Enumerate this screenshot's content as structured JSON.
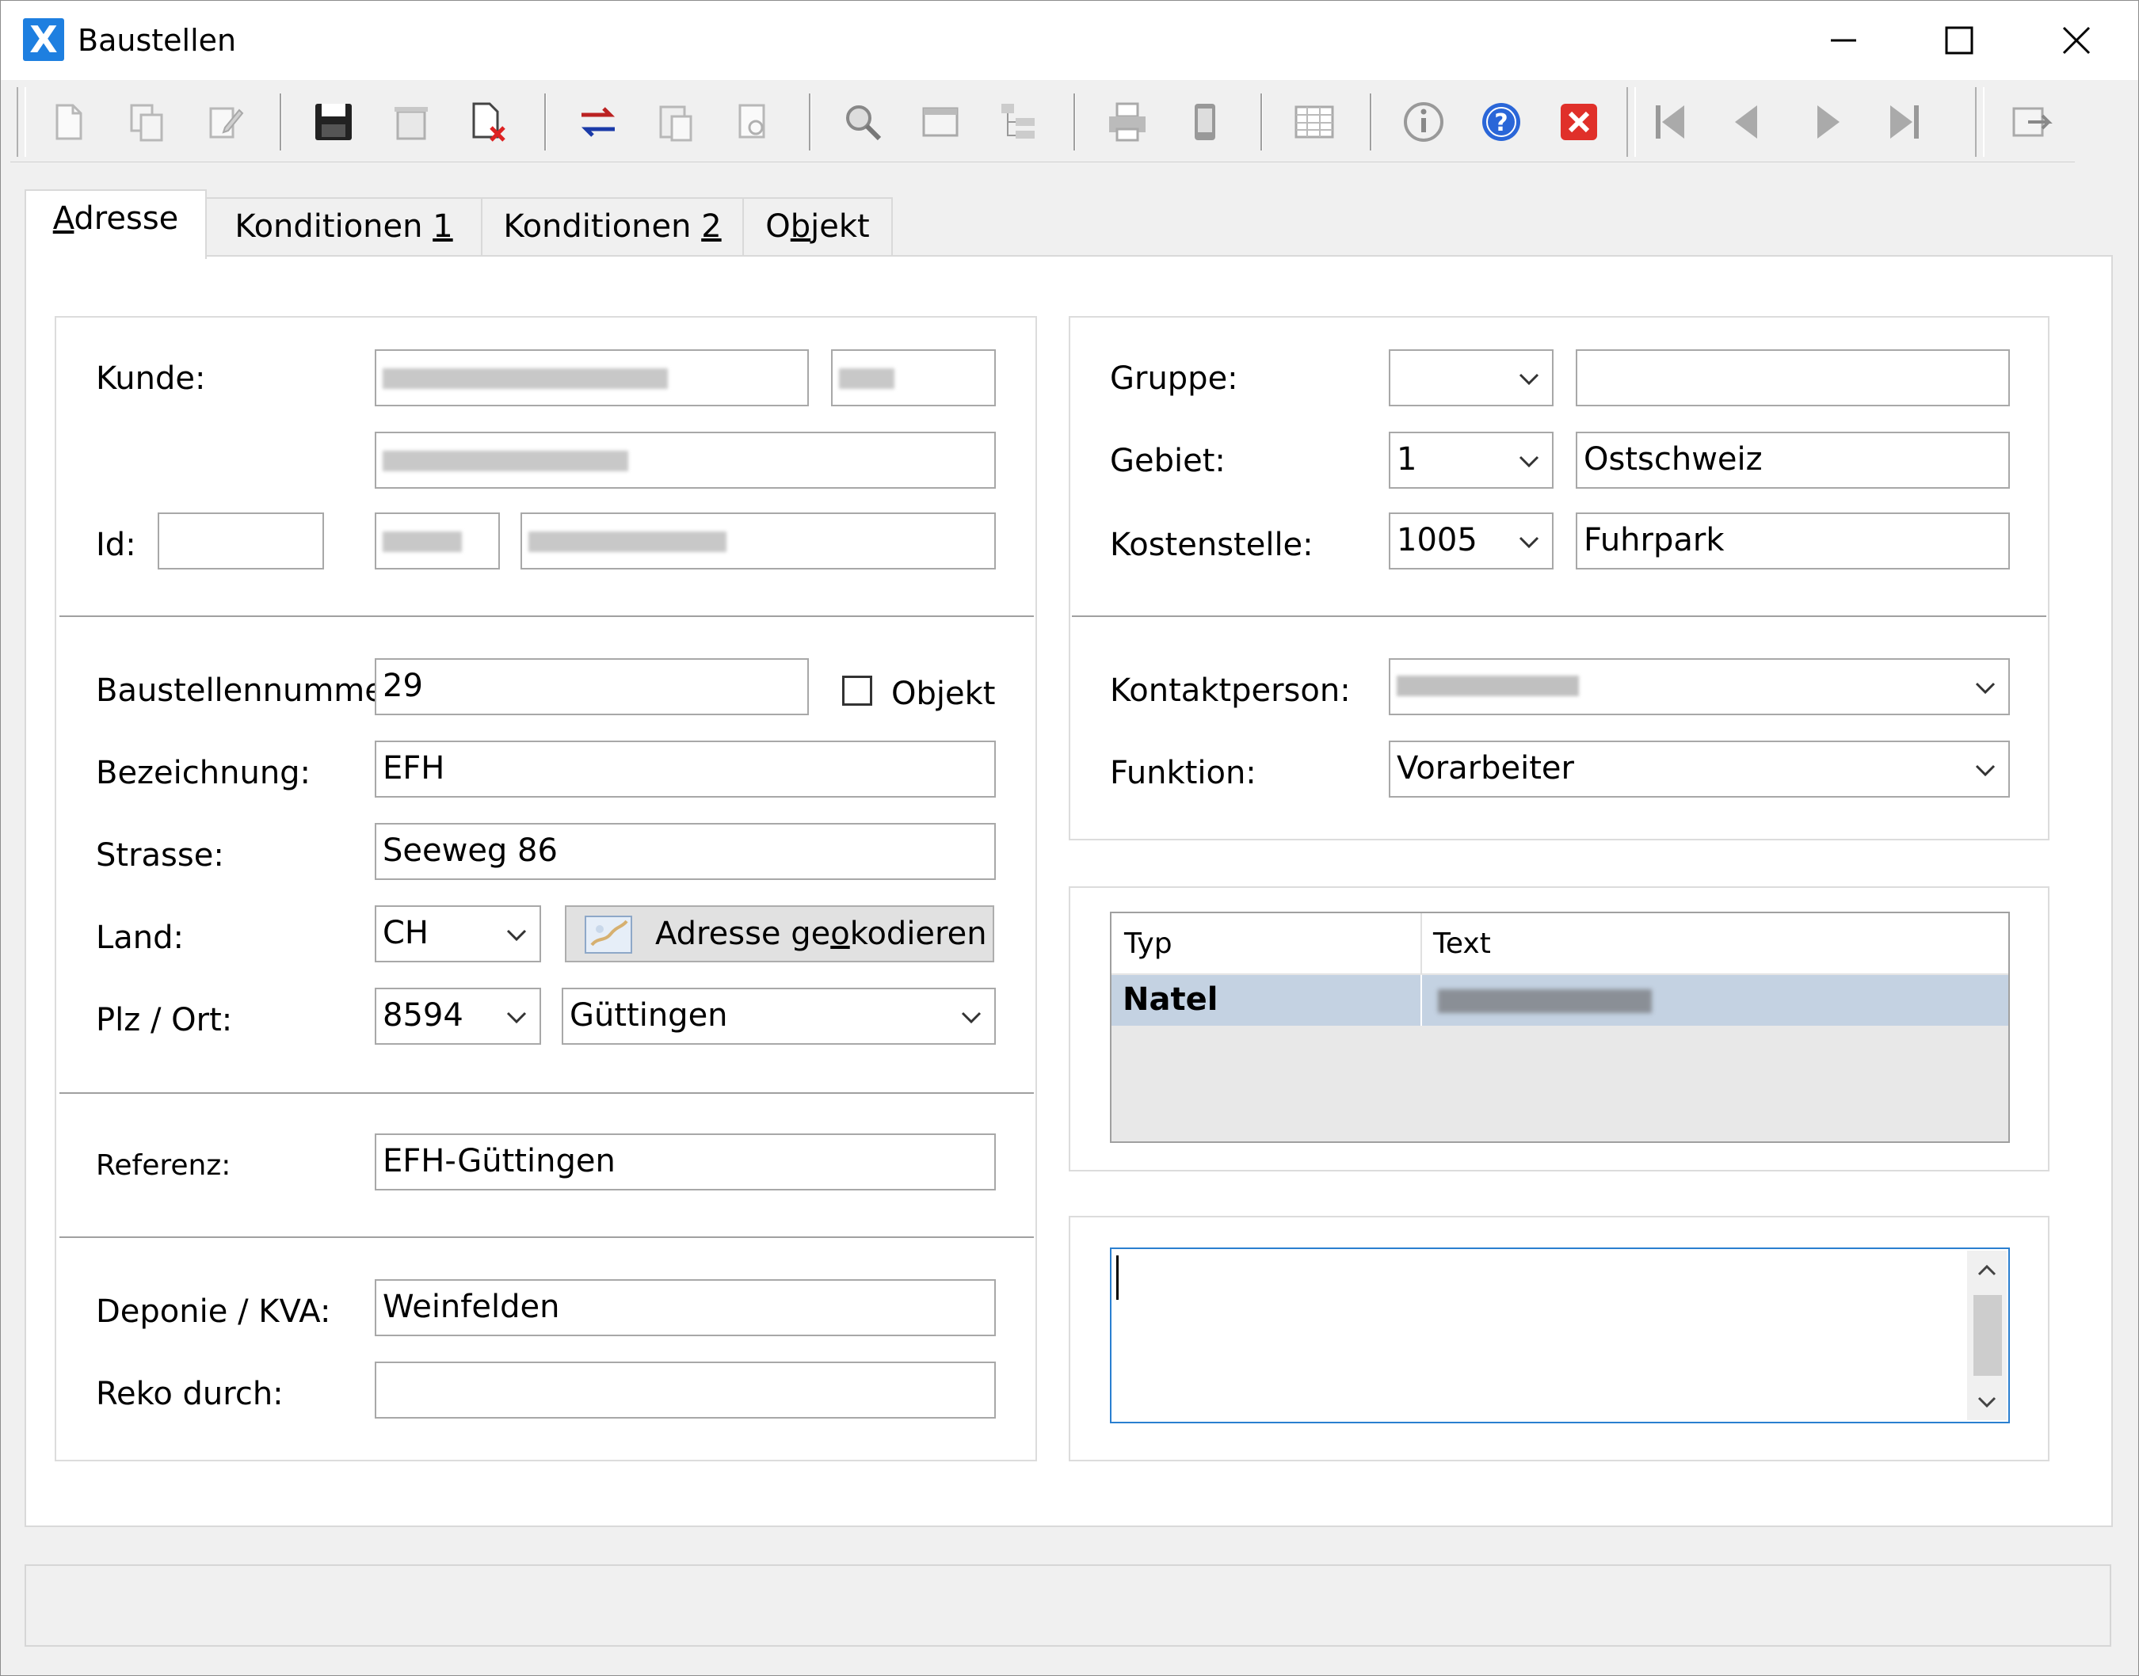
{
  "window": {
    "title": "Baustellen",
    "app_icon_glyph": "X"
  },
  "toolbar": {
    "icons": [
      "new-icon",
      "copy-icon",
      "edit-icon",
      "save-icon",
      "delete-icon",
      "cancel-icon",
      "transfer-icon",
      "paste-icon",
      "preview-icon",
      "search-icon",
      "window-icon",
      "tree-icon",
      "print-icon",
      "mobile-icon",
      "table-icon",
      "info-icon",
      "help-icon",
      "close-red-icon",
      "first-icon",
      "prev-icon",
      "next-icon",
      "last-icon",
      "export-icon"
    ]
  },
  "tabs": [
    {
      "pre": "",
      "u": "A",
      "post": "dresse"
    },
    {
      "pre": "Konditionen ",
      "u": "1",
      "post": ""
    },
    {
      "pre": "Konditionen ",
      "u": "2",
      "post": ""
    },
    {
      "pre": "O",
      "u": "b",
      "post": "jekt"
    }
  ],
  "left": {
    "kunde_label": "Kunde:",
    "id_label": "Id:",
    "id_value": "",
    "baustellennummer_label": "Baustellennumme",
    "baustellennummer_value": "29",
    "objekt_label": "Objekt",
    "bezeichnung_label": "Bezeichnung:",
    "bezeichnung_value": "EFH",
    "strasse_label": "Strasse:",
    "strasse_value": "Seeweg 86",
    "land_label": "Land:",
    "land_value": "CH",
    "geo_button_pre": "Adresse ge",
    "geo_button_u": "o",
    "geo_button_post": "kodieren",
    "plz_label": "Plz / Ort:",
    "plz_value": "8594",
    "ort_value": "Güttingen",
    "referenz_label": "Referenz:",
    "referenz_value": "EFH-Güttingen",
    "deponie_label": "Deponie / KVA:",
    "deponie_value": "Weinfelden",
    "reko_label": "Reko durch:",
    "reko_value": ""
  },
  "right": {
    "gruppe_label": "Gruppe:",
    "gruppe_code": "",
    "gruppe_text": "",
    "gebiet_label": "Gebiet:",
    "gebiet_code": "1",
    "gebiet_text": "Ostschweiz",
    "kostenstelle_label": "Kostenstelle:",
    "kostenstelle_code": "1005",
    "kostenstelle_text": "Fuhrpark",
    "kontaktperson_label": "Kontaktperson:",
    "funktion_label": "Funktion:",
    "funktion_value": "Vorarbeiter",
    "contact_table": {
      "headers": [
        "Typ",
        "Text"
      ],
      "rows": [
        {
          "typ": "Natel"
        }
      ]
    },
    "memo_value": ""
  }
}
